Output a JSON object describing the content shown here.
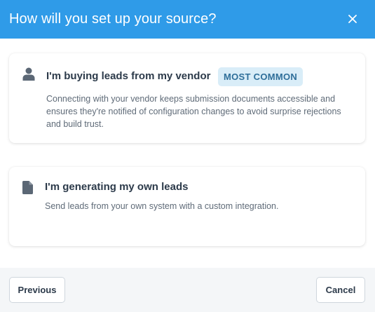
{
  "colors": {
    "header_bg": "#2f9be8",
    "badge_bg": "#d9edf8",
    "badge_fg": "#2f6f9a",
    "icon": "#5b6775"
  },
  "header": {
    "title": "How will you set up your source?",
    "close_icon": "close-icon"
  },
  "options": [
    {
      "icon": "person-icon",
      "title": "I'm buying leads from my vendor",
      "badge": "MOST COMMON",
      "description": "Connecting with your vendor keeps submission documents accessible and ensures they're notified of configuration changes to avoid surprise rejections and build trust."
    },
    {
      "icon": "document-icon",
      "title": "I'm generating my own leads",
      "description": "Send leads from your own system with a custom integration."
    }
  ],
  "footer": {
    "previous_label": "Previous",
    "cancel_label": "Cancel"
  }
}
